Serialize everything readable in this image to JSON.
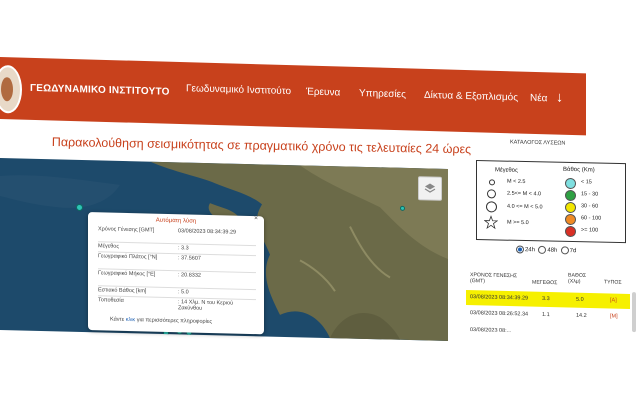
{
  "header": {
    "site_name": "ΓΕΩΔΥΝΑΜΙΚΟ ΙΝΣΤΙΤΟΥΤΟ",
    "nav": [
      "Γεωδυναμικό Ινστιτούτο",
      "Έρευνα",
      "Υπηρεσίες",
      "Δίκτυα & Εξοπλισμός",
      "Νέα"
    ],
    "down_icon": "arrow-down-icon"
  },
  "page_title": "Παρακολούθηση σεισμικότητας σε πραγματικό χρόνο τις τελευταίες 24 ώρες",
  "popup": {
    "title": "Αυτόματη λύση",
    "close": "×",
    "rows": [
      {
        "label": "Χρόνος Γένεσης [GMT]",
        "value": "03/08/2023 08:34:39.29"
      },
      {
        "label": "Μέγεθος",
        "value": ": 3.3"
      },
      {
        "label": "Γεωγραφικό Πλάτος [°N]",
        "value": ": 37.5607"
      },
      {
        "label": "Γεωγραφικό Μήκος [°E]",
        "value": ": 20.8332"
      },
      {
        "label": "Εστιακό Βάθος [km]",
        "value": ": 5.0"
      },
      {
        "label": "Τοποθεσία",
        "value": ": 14 Χλμ. Ν του Κεριού Ζακύνθου"
      }
    ],
    "more_prefix": "Κάντε ",
    "more_link": "κλικ",
    "more_suffix": " για περισσότερες πληροφορίες"
  },
  "catalog": {
    "title": "ΚΑΤΑΛΟΓΟΣ ΛΥΣΕΩΝ",
    "magnitude_header": "Μέγεθος",
    "depth_header": "Βάθος (Km)",
    "magnitudes": [
      "M < 2.5",
      "2.5<= M < 4.0",
      "4.0 <= M < 5.0",
      "M >= 5.0"
    ],
    "depths": [
      "< 15",
      "15 - 30",
      "30 - 60",
      "60 - 100",
      ">= 100"
    ],
    "depth_colors": [
      "#7fdfe0",
      "#2ea043",
      "#f2e600",
      "#f08a24",
      "#d93025"
    ],
    "periods": [
      "24h",
      "48h",
      "7d"
    ],
    "selected_period": "24h"
  },
  "table": {
    "headers": [
      "ΧΡΟΝΟΣ ΓΕΝΕΣΗΣ (GMT)",
      "ΜΕΓΕΘΟΣ",
      "ΒΑΘΟΣ (Χλμ)",
      "ΤΥΠΟΣ"
    ],
    "rows": [
      {
        "time": "03/08/2023 08:34:39.29",
        "mag": "3.3",
        "depth": "5.0",
        "type": "[A]"
      },
      {
        "time": "03/08/2023 08:26:52.34",
        "mag": "1.1",
        "depth": "14.2",
        "type": "[M]"
      },
      {
        "time": "03/08/2023 08:...",
        "mag": "",
        "depth": "",
        "type": ""
      }
    ]
  }
}
